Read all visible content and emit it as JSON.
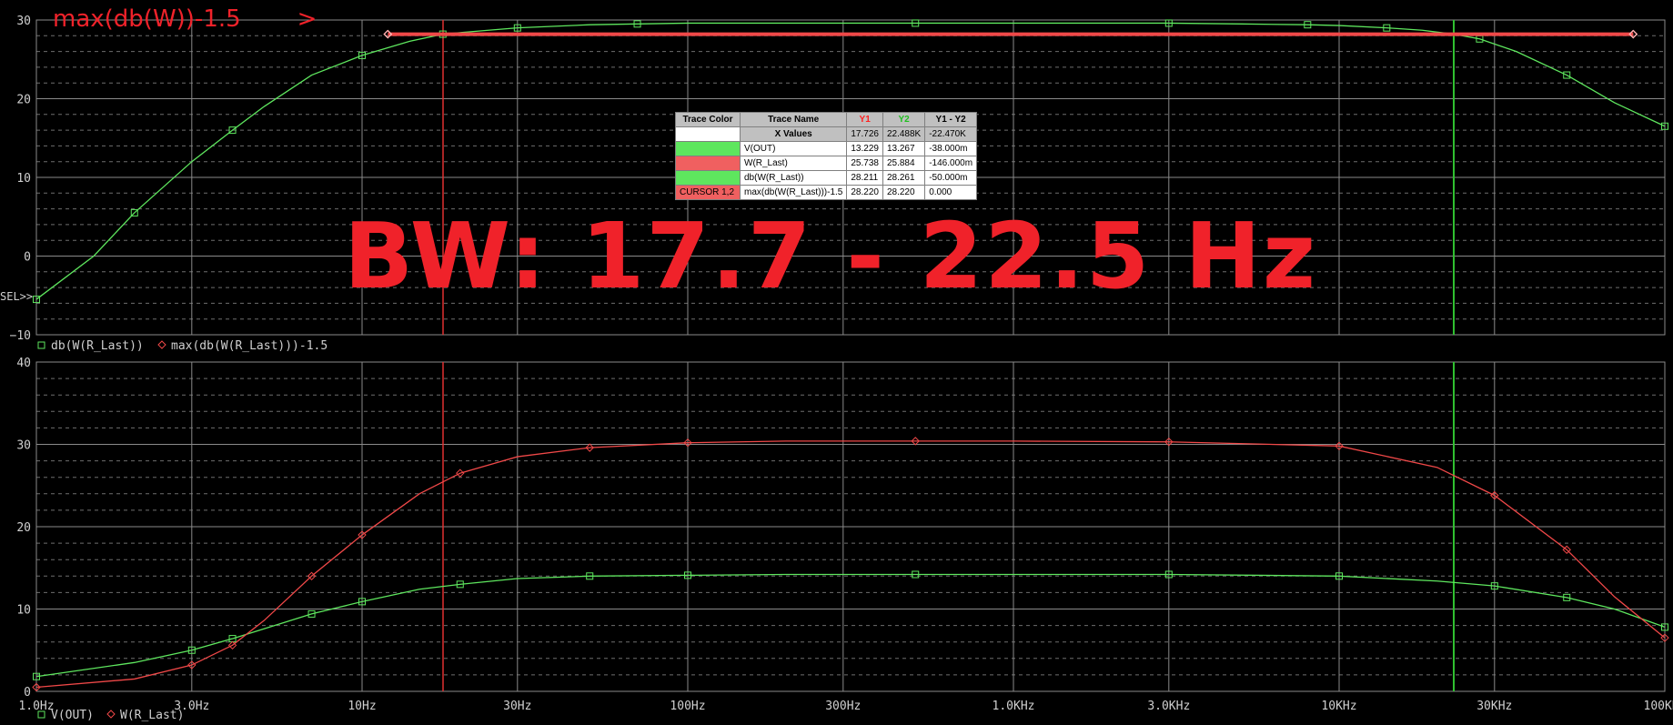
{
  "colors": {
    "background": "#000000",
    "grid_major": "#8a8a8a",
    "grid_minor": "#8a8a8a",
    "green": "#5ee65e",
    "red": "#f04848",
    "axis_text": "#d0d0d0",
    "annotation": "#f0222a"
  },
  "chart_data": [
    {
      "type": "line",
      "panel": "top",
      "x_scale": "log",
      "xlim": [
        1,
        100000
      ],
      "ylim": [
        -10,
        30
      ],
      "yticks": [
        -10,
        0,
        10,
        20,
        30
      ],
      "ytick_labels": [
        "−10",
        "0",
        "10",
        "20",
        "30"
      ],
      "sel_marker": "SEL>>",
      "cursors": {
        "x1": 17.726,
        "x2": 22488
      },
      "legend": [
        {
          "marker": "square",
          "color": "#5ee65e",
          "label": "db(W(R_Last))"
        },
        {
          "marker": "diamond",
          "color": "#f04848",
          "label": "max(db(W(R_Last)))-1.5"
        }
      ],
      "series": [
        {
          "name": "db(W(R_Last))",
          "color": "#5ee65e",
          "marker": "square",
          "x": [
            1,
            1.5,
            2,
            3,
            4,
            5,
            7,
            10,
            14,
            17.7,
            20,
            30,
            50,
            70,
            100,
            200,
            500,
            1000,
            3000,
            5000,
            8000,
            10000,
            14000,
            18000,
            22500,
            27000,
            35000,
            50000,
            70000,
            100000
          ],
          "y": [
            -5.5,
            0,
            5.5,
            12,
            16,
            19,
            23,
            25.5,
            27.3,
            28.2,
            28.4,
            29,
            29.4,
            29.5,
            29.6,
            29.6,
            29.6,
            29.6,
            29.6,
            29.5,
            29.4,
            29.3,
            29.0,
            28.7,
            28.2,
            27.6,
            26,
            23,
            19.5,
            16.5
          ]
        },
        {
          "name": "max(db(W(R_Last)))-1.5",
          "color": "#f04848",
          "marker": "diamond",
          "x": [
            12,
            80000
          ],
          "y": [
            28.2,
            28.2
          ]
        }
      ]
    },
    {
      "type": "line",
      "panel": "bottom",
      "x_scale": "log",
      "xlim": [
        1,
        100000
      ],
      "ylim": [
        0,
        40
      ],
      "yticks": [
        0,
        10,
        20,
        30,
        40
      ],
      "ytick_labels": [
        "0",
        "10",
        "20",
        "30",
        "40"
      ],
      "xtick_labels": [
        {
          "x": 1,
          "label": "1.0Hz"
        },
        {
          "x": 3,
          "label": "3.0Hz"
        },
        {
          "x": 10,
          "label": "10Hz"
        },
        {
          "x": 30,
          "label": "30Hz"
        },
        {
          "x": 100,
          "label": "100Hz"
        },
        {
          "x": 300,
          "label": "300Hz"
        },
        {
          "x": 1000,
          "label": "1.0KHz"
        },
        {
          "x": 3000,
          "label": "3.0KHz"
        },
        {
          "x": 10000,
          "label": "10KHz"
        },
        {
          "x": 30000,
          "label": "30KHz"
        },
        {
          "x": 100000,
          "label": "100KHz"
        }
      ],
      "cursors": {
        "x1": 17.726,
        "x2": 22488
      },
      "legend": [
        {
          "marker": "square",
          "color": "#5ee65e",
          "label": "V(OUT)"
        },
        {
          "marker": "diamond",
          "color": "#f04848",
          "label": "W(R_Last)"
        }
      ],
      "series": [
        {
          "name": "V(OUT)",
          "color": "#5ee65e",
          "marker": "square",
          "x": [
            1,
            2,
            3,
            4,
            5,
            7,
            10,
            15,
            20,
            30,
            50,
            100,
            200,
            500,
            1000,
            3000,
            10000,
            20000,
            30000,
            50000,
            70000,
            100000
          ],
          "y": [
            1.8,
            3.5,
            5,
            6.4,
            7.6,
            9.4,
            10.9,
            12.4,
            13.0,
            13.7,
            14.0,
            14.1,
            14.2,
            14.2,
            14.2,
            14.2,
            14.0,
            13.4,
            12.8,
            11.4,
            10.0,
            7.8
          ]
        },
        {
          "name": "W(R_Last)",
          "color": "#f04848",
          "marker": "diamond",
          "x": [
            1,
            2,
            3,
            4,
            5,
            7,
            10,
            15,
            20,
            30,
            50,
            100,
            200,
            500,
            1000,
            3000,
            10000,
            20000,
            30000,
            50000,
            70000,
            100000
          ],
          "y": [
            0.5,
            1.5,
            3.2,
            5.6,
            8.6,
            14,
            19,
            24,
            26.5,
            28.5,
            29.6,
            30.2,
            30.4,
            30.4,
            30.4,
            30.3,
            29.8,
            27.2,
            23.8,
            17.2,
            11.5,
            6.5
          ]
        }
      ]
    }
  ],
  "cursor_table": {
    "headers": [
      "Trace Color",
      "Trace Name",
      "Y1",
      "Y2",
      "Y1 - Y2"
    ],
    "rows": [
      {
        "color": "",
        "name": "X Values",
        "y1": "17.726",
        "y2": "22.488K",
        "diff": "-22.470K"
      },
      {
        "color": "#5ee65e",
        "name": "V(OUT)",
        "y1": "13.229",
        "y2": "13.267",
        "diff": "-38.000m"
      },
      {
        "color": "#f06060",
        "name": "W(R_Last)",
        "y1": "25.738",
        "y2": "25.884",
        "diff": "-146.000m"
      },
      {
        "color": "#5ee65e",
        "name": "db(W(R_Last))",
        "y1": "28.211",
        "y2": "28.261",
        "diff": "-50.000m"
      },
      {
        "color": "#f06060",
        "label": "CURSOR 1,2",
        "name": "max(db(W(R_Last)))-1.5",
        "y1": "28.220",
        "y2": "28.220",
        "diff": "0.000"
      }
    ]
  },
  "annotations": {
    "bw_text": "BW: 17.7 - 22.5 Hz",
    "top_label": "max(db(W))-1.5",
    "arrow": ">"
  }
}
